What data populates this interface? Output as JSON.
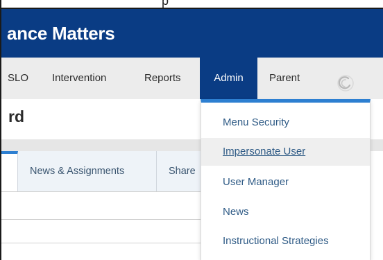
{
  "top_partial_text": "p",
  "header": {
    "title": "ance Matters"
  },
  "nav": {
    "items": [
      {
        "label": "SLO"
      },
      {
        "label": "Intervention"
      },
      {
        "label": "Reports"
      },
      {
        "label": "Admin",
        "active": true
      },
      {
        "label": "Parent"
      }
    ],
    "spinner_icon": "loading-spinner-icon"
  },
  "page": {
    "title": "rd"
  },
  "tabs": [
    {
      "label": "News & Assignments"
    },
    {
      "label": "Share"
    }
  ],
  "admin_menu": {
    "items": [
      {
        "label": "Menu Security"
      },
      {
        "label": "Impersonate User",
        "hovered": true
      },
      {
        "label": "User Manager"
      },
      {
        "label": "News"
      },
      {
        "label": "Instructional Strategies"
      }
    ]
  },
  "colors": {
    "brand_blue": "#0a3c84",
    "accent_blue": "#2d7fd1",
    "menu_link": "#2f5b86",
    "nav_bg": "#ececec"
  }
}
